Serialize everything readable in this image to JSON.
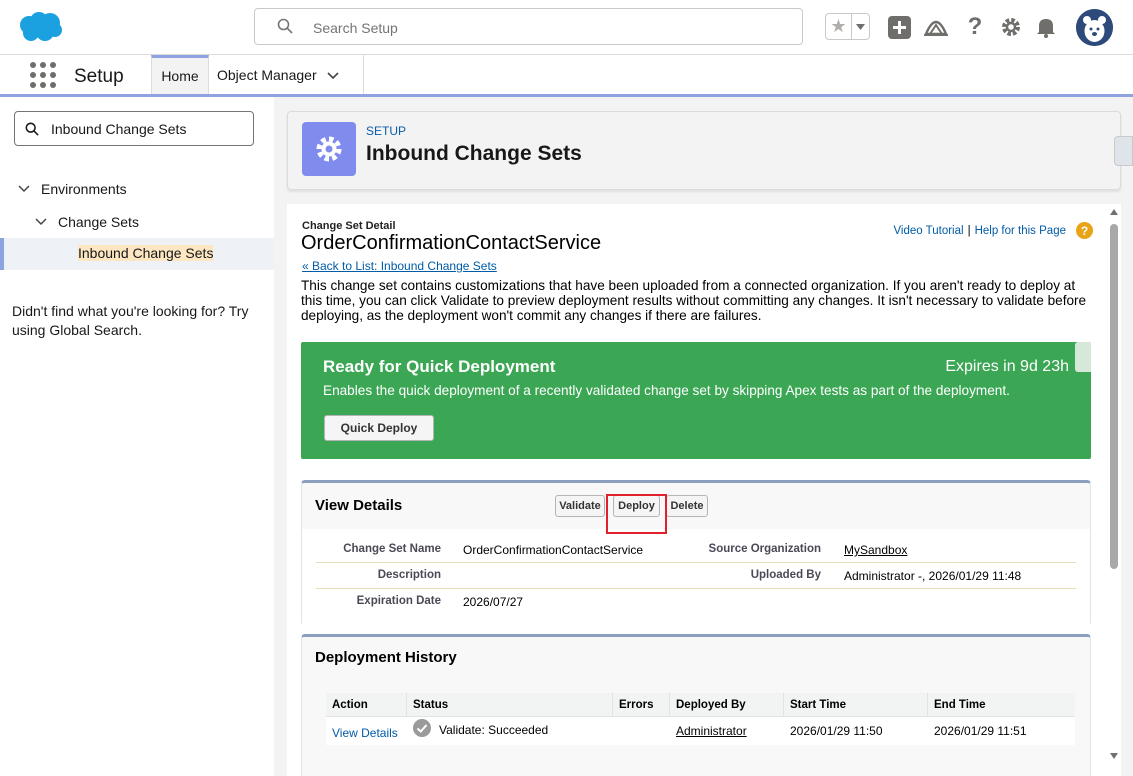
{
  "header": {
    "search_placeholder": "Search Setup"
  },
  "context_bar": {
    "app_title": "Setup",
    "tab_home": "Home",
    "tab_object_manager": "Object Manager"
  },
  "left_nav": {
    "quick_find_value": "Inbound Change Sets",
    "tree": {
      "environments": "Environments",
      "change_sets": "Change Sets",
      "inbound_change_sets": "Inbound Change Sets"
    },
    "not_found_text": "Didn't find what you're looking for? Try using Global Search."
  },
  "page_header": {
    "eyebrow": "SETUP",
    "title": "Inbound Change Sets"
  },
  "detail": {
    "eyebrow": "Change Set Detail",
    "title": "OrderConfirmationContactService",
    "back_link": "« Back to List: Inbound Change Sets",
    "description": "This change set contains customizations that have been uploaded from a connected organization. If you aren't ready to deploy at this time, you can click Validate to preview deployment results without committing any changes. It isn't necessary to validate before deploying, as the deployment won't commit any changes if there are failures.",
    "video_tutorial": "Video Tutorial",
    "separator": "|",
    "help_link": "Help for this Page",
    "help_icon": "?"
  },
  "quick_deploy": {
    "title": "Ready for Quick Deployment",
    "expires": "Expires in 9d 23h",
    "description": "Enables the quick deployment of a recently validated change set by skipping Apex tests as part of the deployment.",
    "button": "Quick Deploy",
    "color": "#3ba755"
  },
  "view_details": {
    "heading": "View Details",
    "buttons": {
      "validate": "Validate",
      "deploy": "Deploy",
      "delete": "Delete"
    },
    "fields": {
      "change_set_name_label": "Change Set Name",
      "change_set_name_value": "OrderConfirmationContactService",
      "description_label": "Description",
      "description_value": "",
      "expiration_date_label": "Expiration Date",
      "expiration_date_value": "2026/07/27",
      "source_org_label": "Source Organization",
      "source_org_value": "MySandbox",
      "uploaded_by_label": "Uploaded By",
      "uploaded_by_value": "Administrator -, 2026/01/29 11:48"
    }
  },
  "deployment_history": {
    "heading": "Deployment History",
    "columns": [
      "Action",
      "Status",
      "Errors",
      "Deployed By",
      "Start Time",
      "End Time"
    ],
    "rows": [
      {
        "action": "View Details",
        "status": "Validate: Succeeded",
        "errors": "",
        "deployed_by": "Administrator",
        "start_time": "2026/01/29 11:50",
        "end_time": "2026/01/29 11:51"
      }
    ]
  },
  "colors": {
    "accent": "#8fa2e0",
    "brand_cloud": "#1ba1e0",
    "setup_icon_bg": "#7f8ced",
    "highlight": "#e0202a"
  }
}
